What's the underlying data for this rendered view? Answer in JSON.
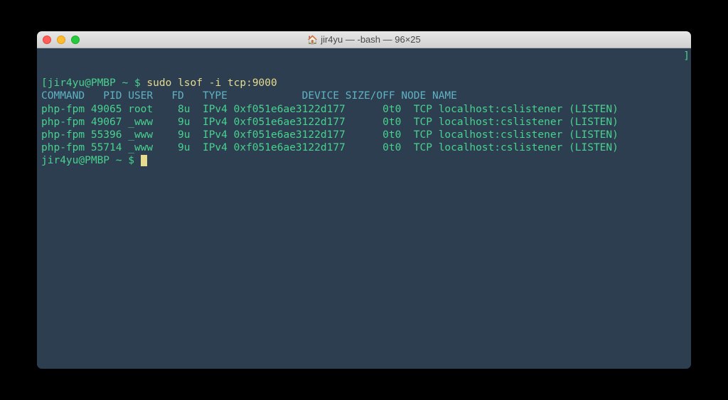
{
  "window": {
    "title": "jir4yu — -bash — 96×25",
    "home_icon": "🏠"
  },
  "terminal": {
    "prompt1_open": "[",
    "prompt1_user": "jir4yu@PMBP ~ $ ",
    "prompt1_close_pre": "",
    "command1": "sudo lsof -i tcp:9000",
    "header": "COMMAND   PID USER   FD   TYPE            DEVICE SIZE/OFF NODE NAME",
    "rows": [
      "php-fpm 49065 root    8u  IPv4 0xf051e6ae3122d177      0t0  TCP localhost:cslistener (LISTEN)",
      "php-fpm 49067 _www    9u  IPv4 0xf051e6ae3122d177      0t0  TCP localhost:cslistener (LISTEN)",
      "php-fpm 55396 _www    9u  IPv4 0xf051e6ae3122d177      0t0  TCP localhost:cslistener (LISTEN)",
      "php-fpm 55714 _www    9u  IPv4 0xf051e6ae3122d177      0t0  TCP localhost:cslistener (LISTEN)"
    ],
    "prompt2_open": "",
    "prompt2_user": "jir4yu@PMBP ~ $ ",
    "scroll_indicator": "]"
  }
}
